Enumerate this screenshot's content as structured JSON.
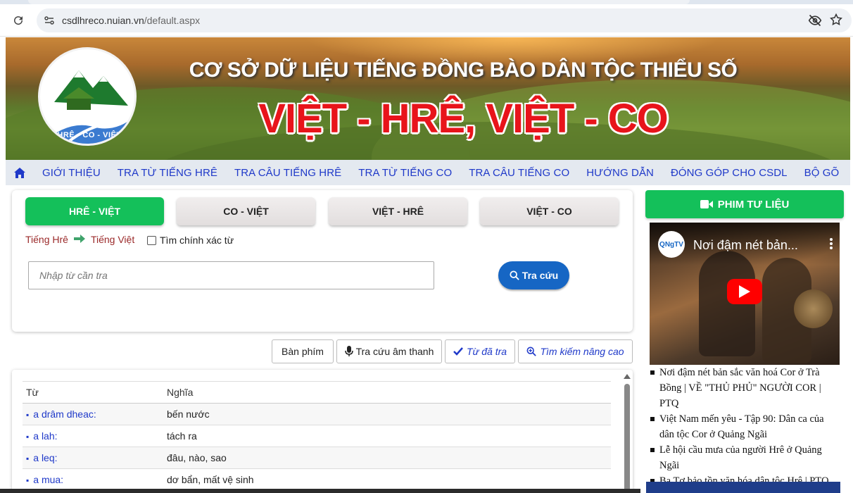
{
  "browser": {
    "url_domain": "csdlhreco.nuian.vn",
    "url_path": "/default.aspx"
  },
  "banner": {
    "title": "CƠ SỞ DỮ LIỆU TIẾNG ĐỒNG BÀO DÂN TỘC THIỂU SỐ",
    "subtitle": "VIỆT - HRÊ, VIỆT - CO",
    "logo_text": "HRÊ - CO - VIỆT"
  },
  "nav": {
    "home_icon": "home-icon",
    "items": [
      "GIỚI THIỆU",
      "TRA TỪ TIẾNG HRÊ",
      "TRA CÂU TIẾNG HRÊ",
      "TRA TỪ TIẾNG CO",
      "TRA CÂU TIẾNG CO",
      "HƯỚNG DẪN",
      "ĐÓNG GÓP CHO CSDL",
      "BỘ GÕ"
    ]
  },
  "search": {
    "tabs": [
      "HRÊ - VIỆT",
      "CO - VIỆT",
      "VIỆT - HRÊ",
      "VIỆT - CO"
    ],
    "active_tab": "HRÊ - VIỆT",
    "from_lang": "Tiếng Hrê",
    "to_lang": "Tiếng Việt",
    "exact_label": "Tìm chính xác từ",
    "input_placeholder": "Nhập từ cần tra",
    "search_label": "Tra cứu"
  },
  "tools": {
    "keyboard": "Bàn phím",
    "voice": "Tra cứu âm thanh",
    "history": "Từ đã tra",
    "advanced": "Tìm kiếm nâng cao"
  },
  "results": {
    "col_word": "Từ",
    "col_meaning": "Nghĩa",
    "rows": [
      {
        "word": "a drâm dheac:",
        "meaning": "bến nước"
      },
      {
        "word": "a lah:",
        "meaning": "tách ra"
      },
      {
        "word": "a leq:",
        "meaning": "đâu, nào, sao"
      },
      {
        "word": "a mua:",
        "meaning": "dơ bẩn, mất vệ sinh"
      }
    ]
  },
  "sidebar": {
    "header": "PHIM TƯ LIỆU",
    "video_channel": "QNgTV",
    "video_title": "Nơi đậm nét bản...",
    "videos": [
      "Nơi đậm nét bản sắc văn hoá Cor ở Trà Bồng | VỀ \"THỦ PHỦ\" NGƯỜI COR | PTQ",
      "Việt Nam mến yêu - Tập 90: Dân ca của dân tộc Cor ở Quảng Ngãi",
      "Lễ hội cầu mưa của người Hrê ở Quảng Ngãi",
      "Ba Tơ bảo tồn văn hóa dân tộc Hrê | PTQ"
    ]
  },
  "colors": {
    "nav_link": "#1f39c9",
    "green": "#14c05a",
    "search_blue": "#1666c4",
    "banner_red": "#e8141b"
  }
}
